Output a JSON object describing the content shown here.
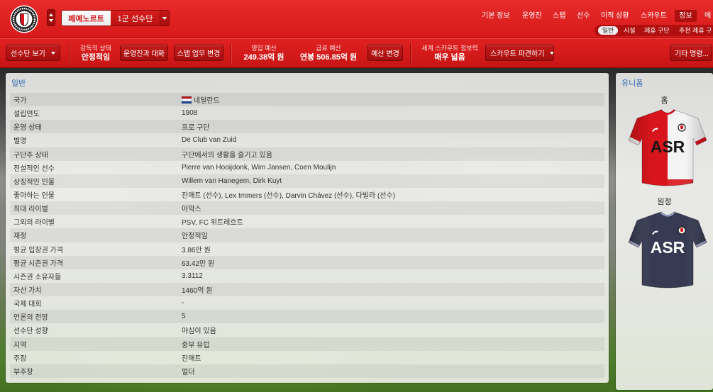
{
  "header": {
    "club_tab": "페예노르트",
    "squad_tab": "1군 선수단",
    "nav": [
      {
        "label": "기본 정보"
      },
      {
        "label": "운영진"
      },
      {
        "label": "스탭"
      },
      {
        "label": "선수"
      },
      {
        "label": "이적 상황"
      },
      {
        "label": "스카우트"
      },
      {
        "label": "정보",
        "active": true
      },
      {
        "label": "메"
      }
    ],
    "subtabs": [
      {
        "label": "일반",
        "active": true
      },
      {
        "label": "시설"
      },
      {
        "label": "제휴 구단"
      },
      {
        "label": "추천 제휴 구"
      }
    ],
    "icons": {
      "crest": "club-crest-logo",
      "switch_up": "arrow-up-icon",
      "switch_down": "arrow-down-icon",
      "dropdown": "chevron-down-icon"
    }
  },
  "toolbar": {
    "squad_view": "선수단 보기",
    "manager_status_label": "감독직 상태",
    "manager_status_value": "안정적임",
    "talk_board": "운영진과 대화",
    "staff_duties": "스탭 업무 변경",
    "transfer_budget_label": "영입 예산",
    "transfer_budget_value": "249.38억 원",
    "wage_budget_label": "급료 예산",
    "wage_budget_value": "연봉 506.85억 원",
    "change_budget": "예산 변경",
    "scouting_label": "세계 스카우트 정보력",
    "scouting_value": "매우 넓음",
    "send_scout": "스카우트 파견하기",
    "other_orders": "기타 명령..."
  },
  "general": {
    "title": "일반",
    "rows": [
      {
        "label": "국가",
        "value": "네덜란드",
        "flag": {
          "icon": "netherlands-flag-icon",
          "colors": [
            "#ae1c28",
            "#ffffff",
            "#21468b"
          ]
        }
      },
      {
        "label": "설립연도",
        "value": "1908"
      },
      {
        "label": "운영 상태",
        "value": "프로 구단"
      },
      {
        "label": "별명",
        "value": "De Club van Zuid"
      },
      {
        "label": "구단주 상태",
        "value": "구단에서의 생활을 즐기고 있음"
      },
      {
        "label": "전설적인 선수",
        "value": "Pierre van Hooijdonk, Wim Jansen, Coen Moulijn"
      },
      {
        "label": "상징적인 인물",
        "value": "Willem van Hanegem, Dirk Kuyt"
      },
      {
        "label": "좋아하는 인물",
        "value": "잔매트 (선수), Lex Immers (선수), Darvin Chávez (선수), 다빌라 (선수)"
      },
      {
        "label": "최대 라이벌",
        "value": "아약스"
      },
      {
        "label": "그외의 라이벌",
        "value": "PSV, FC 위트레흐트"
      },
      {
        "label": "재정",
        "value": "안정적임"
      },
      {
        "label": "평균 입장권 가격",
        "value": "3.86만 원"
      },
      {
        "label": "평균 시즌권 가격",
        "value": "63.42만 원"
      },
      {
        "label": "시즌권 소유자들",
        "value": "3.3112"
      },
      {
        "label": "자산 가치",
        "value": "1460억 원"
      },
      {
        "label": "국제 대회",
        "value": "-"
      },
      {
        "label": "언론의 전망",
        "value": "5"
      },
      {
        "label": "선수단 성향",
        "value": "야심이 있음"
      },
      {
        "label": "지역",
        "value": "중부 유럽"
      },
      {
        "label": "주장",
        "value": "잔매트"
      },
      {
        "label": "부주장",
        "value": "멀더"
      }
    ]
  },
  "kits": {
    "title": "유니폼",
    "home": {
      "label": "홈",
      "sponsor": "ASR",
      "colors": {
        "primary": "#d8151c",
        "secondary": "#f4f4f4",
        "text": "#161616"
      }
    },
    "away": {
      "label": "원정",
      "sponsor": "ASR",
      "colors": {
        "primary": "#2b3049",
        "trim": "#a9b0d8",
        "text": "#ffffff"
      }
    }
  },
  "theme": {
    "header_red": "#e11f1f",
    "button_red": "#b31414",
    "title_blue": "#2d6bb3"
  }
}
